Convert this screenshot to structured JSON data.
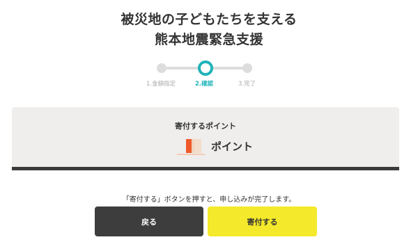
{
  "header": {
    "title_line1": "被災地の子どもたちを支える",
    "title_line2": "熊本地震緊急支援"
  },
  "stepper": {
    "steps": [
      {
        "label": "1.金額指定",
        "state": "done"
      },
      {
        "label": "2.確認",
        "state": "active"
      },
      {
        "label": "3.完了",
        "state": "pending"
      }
    ],
    "active_color": "#1fb3b8",
    "inactive_color": "#dddddd"
  },
  "summary": {
    "label": "寄付するポイント",
    "value_suffix": "ポイント",
    "icon": "points-bar-icon"
  },
  "notice": "「寄付する」ボタンを押すと、申し込みが完了します。",
  "actions": {
    "back_label": "戻る",
    "donate_label": "寄付する",
    "donate_color": "#f4e92a",
    "back_color": "#3d3d3d"
  }
}
